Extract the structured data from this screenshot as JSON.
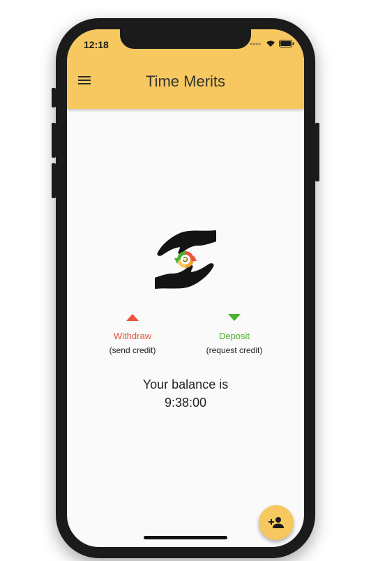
{
  "status_bar": {
    "time": "12:18"
  },
  "appbar": {
    "title": "Time Merits",
    "menu_icon": "hamburger-menu-icon"
  },
  "actions": {
    "withdraw": {
      "label": "Withdraw",
      "sublabel": "(send credit)",
      "color": "#e8533c",
      "icon": "triangle-up-icon"
    },
    "deposit": {
      "label": "Deposit",
      "sublabel": "(request credit)",
      "color": "#4caf2f",
      "icon": "triangle-down-icon"
    }
  },
  "balance": {
    "label": "Your balance is",
    "value": "9:38:00"
  },
  "fab": {
    "icon": "add-person-icon"
  },
  "colors": {
    "accent": "#f6c85f",
    "background": "#fafafa"
  }
}
